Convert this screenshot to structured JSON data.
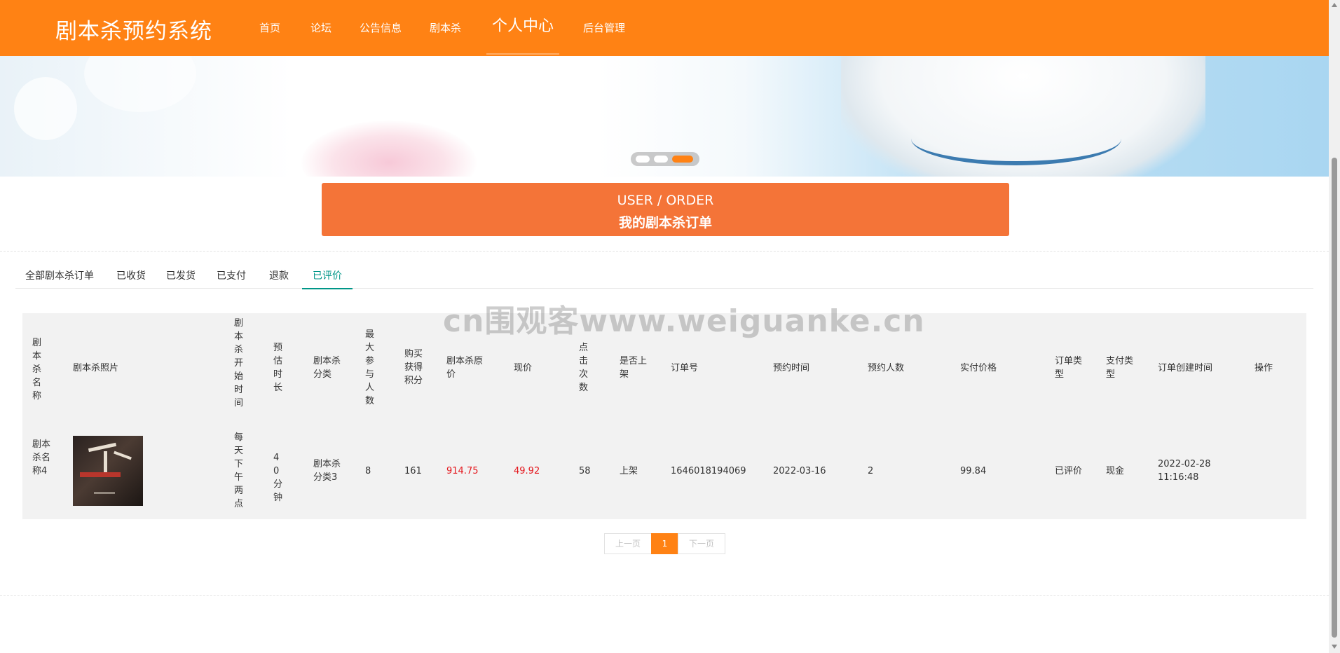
{
  "header": {
    "site_title": "剧本杀预约系统",
    "nav": [
      {
        "label": "首页",
        "active": false
      },
      {
        "label": "论坛",
        "active": false
      },
      {
        "label": "公告信息",
        "active": false
      },
      {
        "label": "剧本杀",
        "active": false
      },
      {
        "label": "个人中心",
        "active": true
      },
      {
        "label": "后台管理",
        "active": false
      }
    ]
  },
  "banner": {
    "active_slide": 3,
    "slide_count": 3
  },
  "title_bar": {
    "en": "USER / ORDER",
    "cn": "我的剧本杀订单"
  },
  "tabs": [
    {
      "label": "全部剧本杀订单",
      "active": false
    },
    {
      "label": "已收货",
      "active": false
    },
    {
      "label": "已发货",
      "active": false
    },
    {
      "label": "已支付",
      "active": false
    },
    {
      "label": "退款",
      "active": false
    },
    {
      "label": "已评价",
      "active": true
    }
  ],
  "table": {
    "headers": [
      "剧本杀名称",
      "剧本杀照片",
      "剧本杀开始时间",
      "预估时长",
      "剧本杀分类",
      "最大参与人数",
      "购买获得积分",
      "剧本杀原价",
      "现价",
      "点击次数",
      "是否上架",
      "订单号",
      "预约时间",
      "预约人数",
      "实付价格",
      "订单类型",
      "支付类型",
      "订单创建时间",
      "操作"
    ],
    "rows": [
      {
        "name": "剧本杀名称4",
        "start_time": "每天下午两点",
        "duration": "40分钟",
        "category": "剧本杀分类3",
        "max_people": "8",
        "points": "161",
        "original_price": "914.75",
        "current_price": "49.92",
        "clicks": "58",
        "on_shelf": "上架",
        "order_no": "1646018194069",
        "reserve_time": "2022-03-16",
        "reserve_count": "2",
        "paid_price": "99.84",
        "order_type": "已评价",
        "pay_type": "现金",
        "created_at": "2022-02-28 11:16:48",
        "action": ""
      }
    ]
  },
  "pagination": {
    "prev": "上一页",
    "current": "1",
    "next": "下一页"
  },
  "watermark": "cn围观客www.weiguanke.cn",
  "colors": {
    "brand": "#ff8214",
    "title_bar": "#f47438",
    "tab_active": "#009688",
    "price_red": "#e4161c"
  }
}
